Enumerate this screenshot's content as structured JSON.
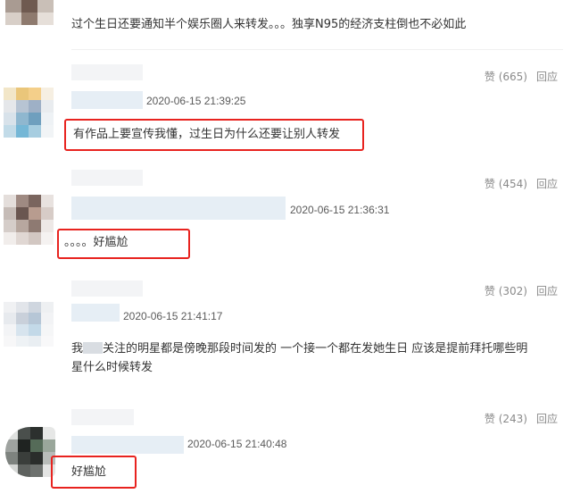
{
  "comments": [
    {
      "text": "过个生日还要通知半个娱乐圈人来转发。。。独享N95的经济支柱倒也不必如此",
      "likes_label": "赞 (665)",
      "reply_label": "回应"
    },
    {
      "timestamp": "2020-06-15 21:39:25",
      "text": "有作品上要宣传我懂，过生日为什么还要让别人转发",
      "likes_label": "赞 (454)",
      "reply_label": "回应"
    },
    {
      "timestamp": "2020-06-15 21:36:31",
      "text": "。。。。好尴尬",
      "likes_label": "赞 (302)",
      "reply_label": "回应"
    },
    {
      "timestamp": "2020-06-15 21:41:17",
      "text_prefix": "我",
      "text_line1": "关注的明星都是傍晚那段时间发的 一个接一个都在发她生日 应该是提前拜托哪些明",
      "text_line2": "星什么时候转发",
      "likes_label": "赞 (243)",
      "reply_label": "回应"
    },
    {
      "timestamp": "2020-06-15 21:40:48",
      "text": "好尴尬"
    }
  ],
  "colors": {
    "highlight_box": "#e8231f",
    "action_text": "#8a8a8a",
    "body_text": "#333333"
  }
}
